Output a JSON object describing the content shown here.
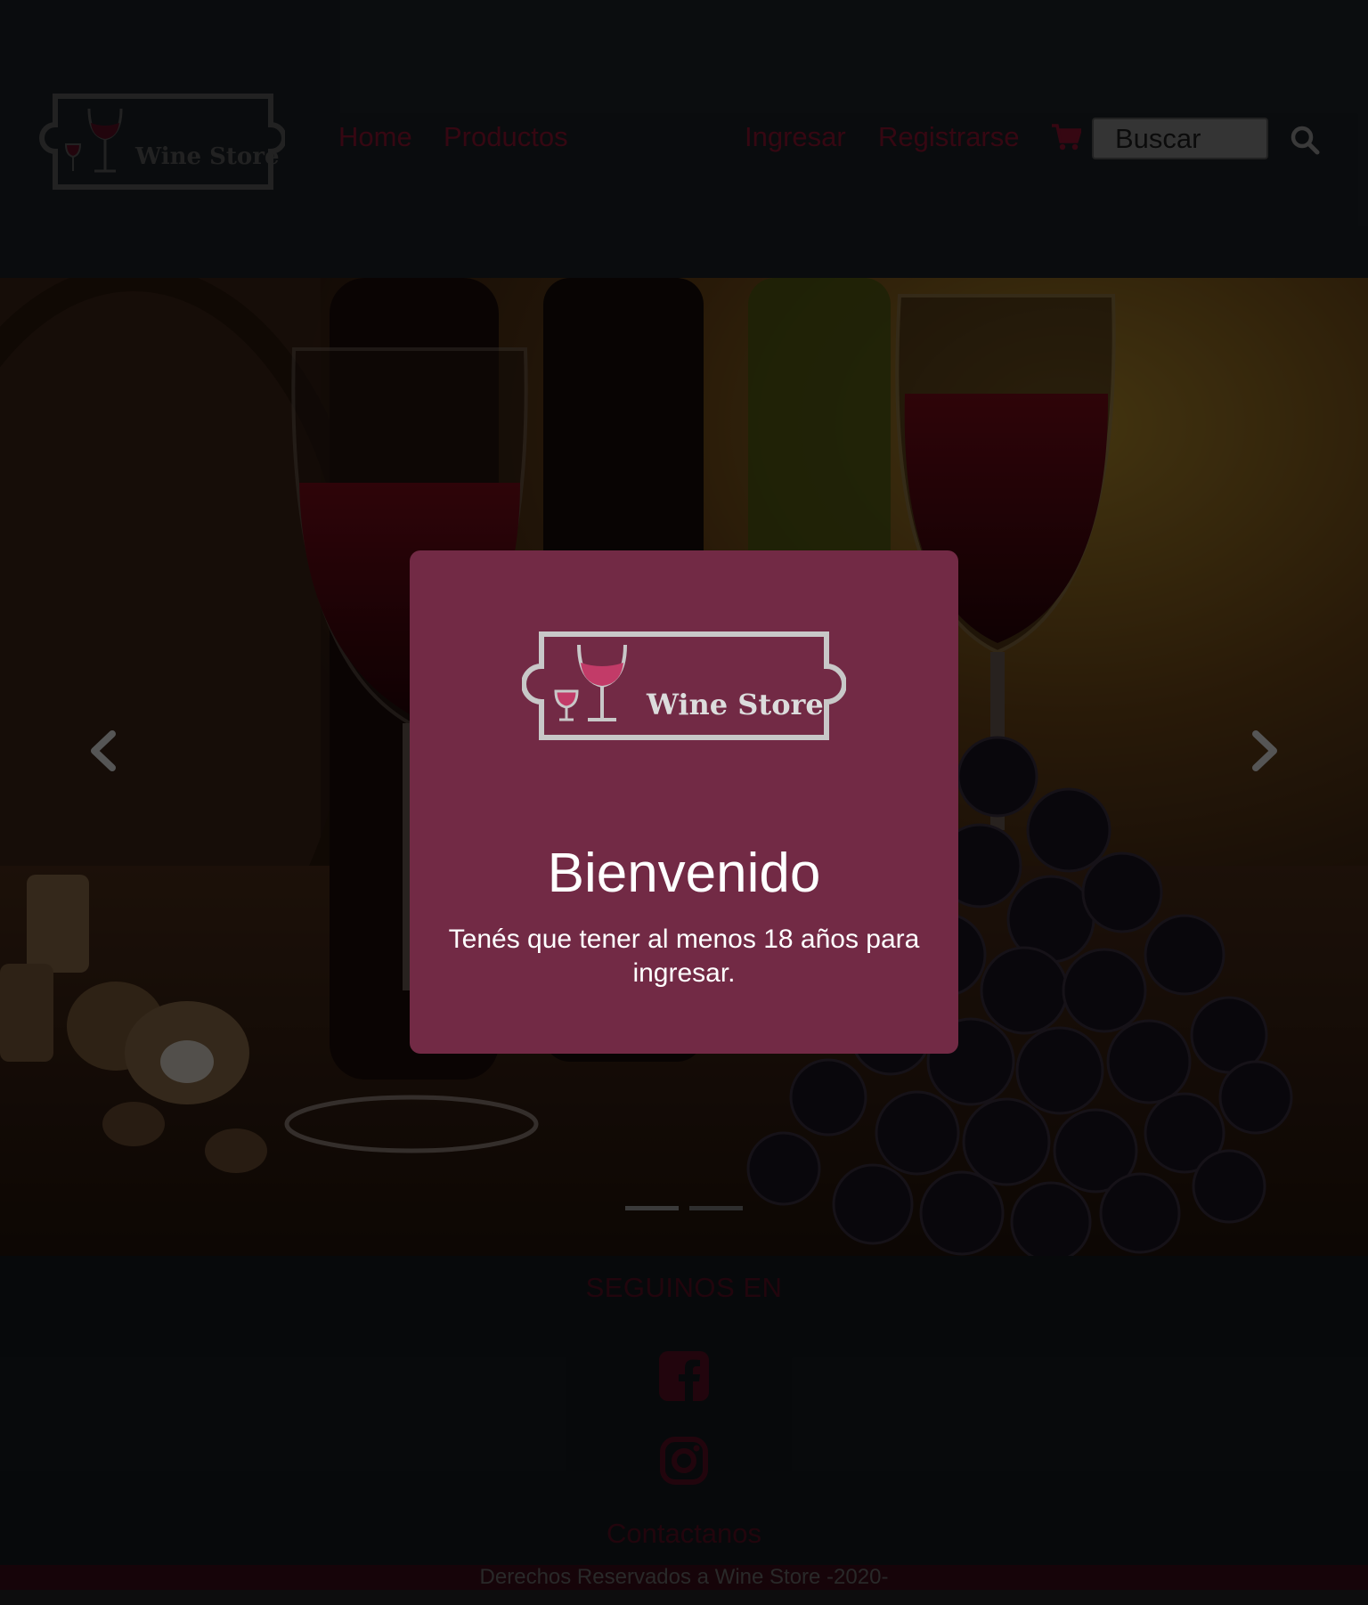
{
  "header": {
    "logo_text": "Wine Store",
    "nav": {
      "home": "Home",
      "products": "Productos",
      "login": "Ingresar",
      "register": "Registrarse"
    },
    "search_placeholder": "Buscar",
    "icons": {
      "cart": "shopping-cart-icon",
      "search": "magnifier-icon"
    }
  },
  "carousel": {
    "slide_count": 2,
    "active_slide": 1,
    "icons": {
      "prev": "chevron-left-icon",
      "next": "chevron-right-icon"
    }
  },
  "modal": {
    "logo_text": "Wine Store",
    "title": "Bienvenido",
    "message": "Tenés que tener al menos 18 años para ingresar."
  },
  "footer": {
    "follow_title": "SEGUINOS EN",
    "social_icons": [
      "facebook-icon",
      "instagram-icon"
    ],
    "contact": "Contactanos",
    "copyright": "Derechos Reservados a Wine Store -2020-"
  },
  "colors": {
    "brand_wine": "#8e1330",
    "modal_bg": "#722a45",
    "header_bg": "#1c2127",
    "footer_bar": "#3a0d18"
  }
}
